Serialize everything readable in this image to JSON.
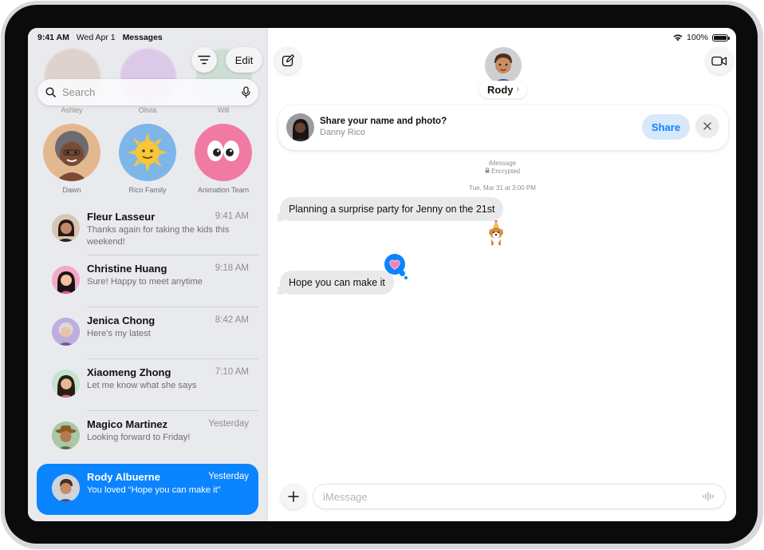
{
  "status": {
    "time": "9:41 AM",
    "date": "Wed Apr 1",
    "app": "Messages",
    "battery": "100%"
  },
  "sidebar": {
    "edit_label": "Edit",
    "search_placeholder": "Search",
    "ghost_pins": [
      "Ashley",
      "Olivia",
      "Will"
    ],
    "pins": [
      {
        "name": "Dawn"
      },
      {
        "name": "Rico Family"
      },
      {
        "name": "Animation Team"
      }
    ],
    "conversations": [
      {
        "name": "Fleur Lasseur",
        "time": "9:41 AM",
        "preview": "Thanks again for taking the kids this weekend!"
      },
      {
        "name": "Christine Huang",
        "time": "9:18 AM",
        "preview": "Sure! Happy to meet anytime"
      },
      {
        "name": "Jenica Chong",
        "time": "8:42 AM",
        "preview": "Here's my latest"
      },
      {
        "name": "Xiaomeng Zhong",
        "time": "7:10 AM",
        "preview": "Let me know what she says"
      },
      {
        "name": "Magico Martinez",
        "time": "Yesterday",
        "preview": "Looking forward to Friday!"
      },
      {
        "name": "Rody Albuerne",
        "time": "Yesterday",
        "preview": "You loved “Hope you can make it”"
      }
    ]
  },
  "main": {
    "contact_name": "Rody",
    "contact_chevron": "›",
    "share_card": {
      "title": "Share your name and photo?",
      "subtitle": "Danny Rico",
      "share_label": "Share"
    },
    "service": "iMessage",
    "encrypted": "Encrypted",
    "timestamp": "Tue, Mar 31 at 3:00 PM",
    "messages": [
      {
        "text": "Planning a surprise party for Jenny on the 21st"
      },
      {
        "text": "Hope you can make it"
      }
    ],
    "input_placeholder": "iMessage"
  },
  "colors": {
    "accent": "#0a84ff",
    "bubble": "#e9e9eb",
    "sidebar": "#e9eaee"
  }
}
